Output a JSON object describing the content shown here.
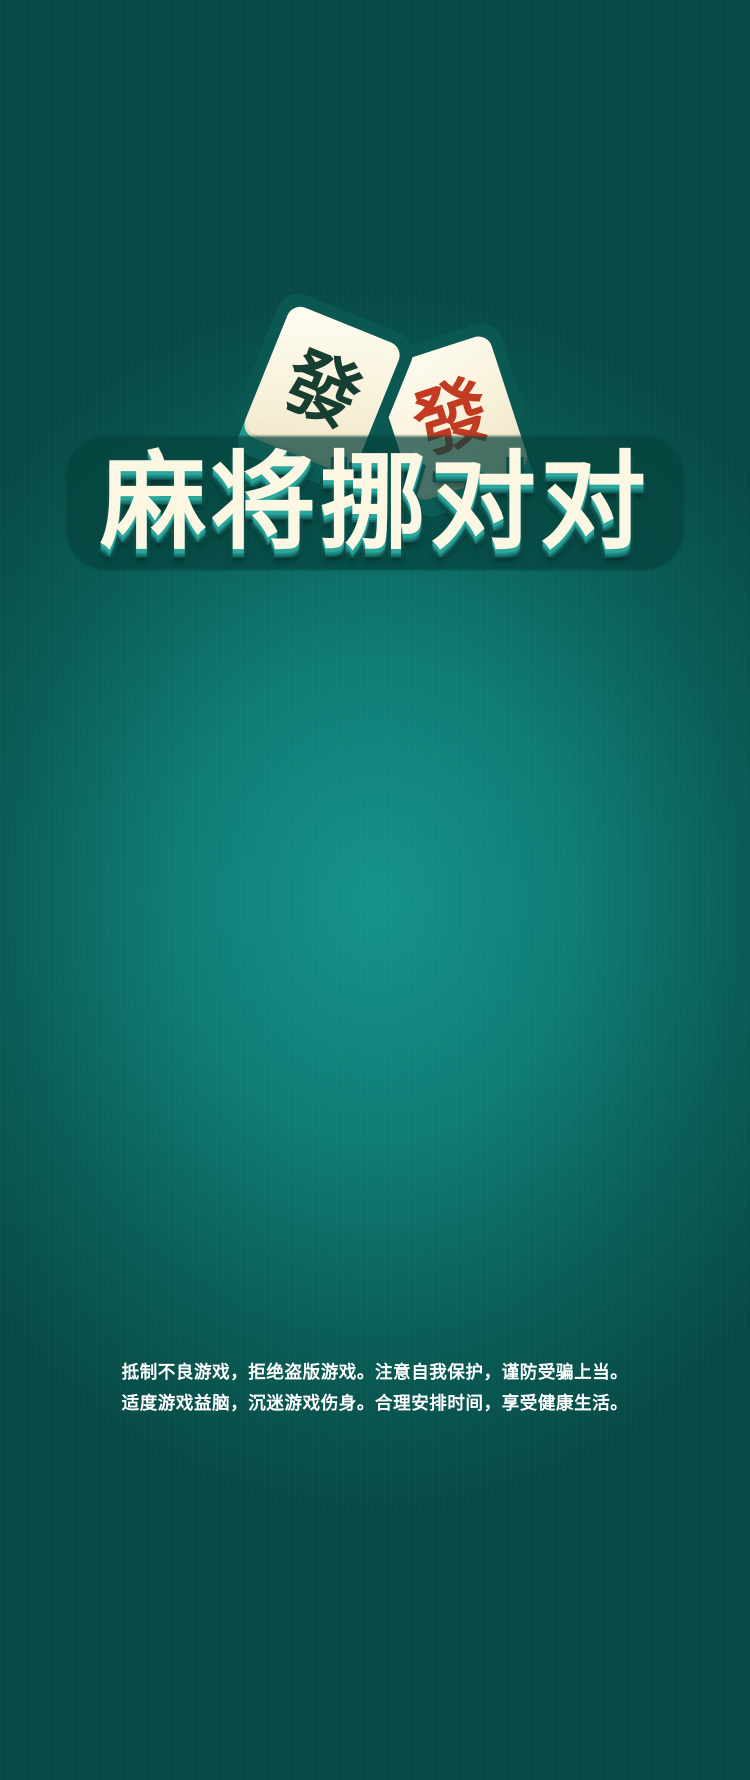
{
  "logo": {
    "title": "麻将挪对对",
    "tiles": [
      {
        "glyph": "發",
        "color": "#163f32"
      },
      {
        "glyph": "發",
        "color": "#c23a22"
      }
    ]
  },
  "notice": {
    "line1": "抵制不良游戏，拒绝盗版游戏。注意自我保护，谨防受骗上当。",
    "line2": "适度游戏益脑，沉迷游戏伤身。合理安排时间，享受健康生活。"
  },
  "colors": {
    "background_center": "#15938b",
    "background_edge": "#074944",
    "title_face": "#fbf7e3",
    "title_edge": "#2aa79d"
  }
}
